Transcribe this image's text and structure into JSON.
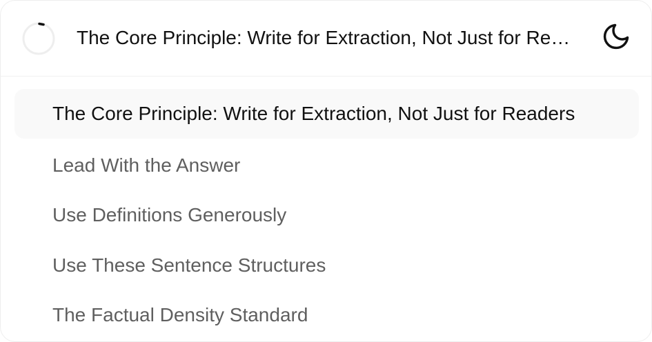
{
  "header": {
    "title": "The Core Principle: Write for Extraction, Not Just for Readers",
    "progress_icon": "progress-ring-icon",
    "theme_icon": "moon-icon"
  },
  "toc": {
    "items": [
      {
        "label": "The Core Principle: Write for Extraction, Not Just for Readers",
        "active": true
      },
      {
        "label": "Lead With the Answer",
        "active": false
      },
      {
        "label": "Use Definitions Generously",
        "active": false
      },
      {
        "label": "Use These Sentence Structures",
        "active": false
      },
      {
        "label": "The Factual Density Standard",
        "active": false
      }
    ]
  },
  "colors": {
    "active_text": "#111111",
    "inactive_text": "#5f5f5f",
    "active_bg": "#f9f9f9",
    "ring_track": "#eeeeee",
    "ring_progress": "#111111"
  }
}
